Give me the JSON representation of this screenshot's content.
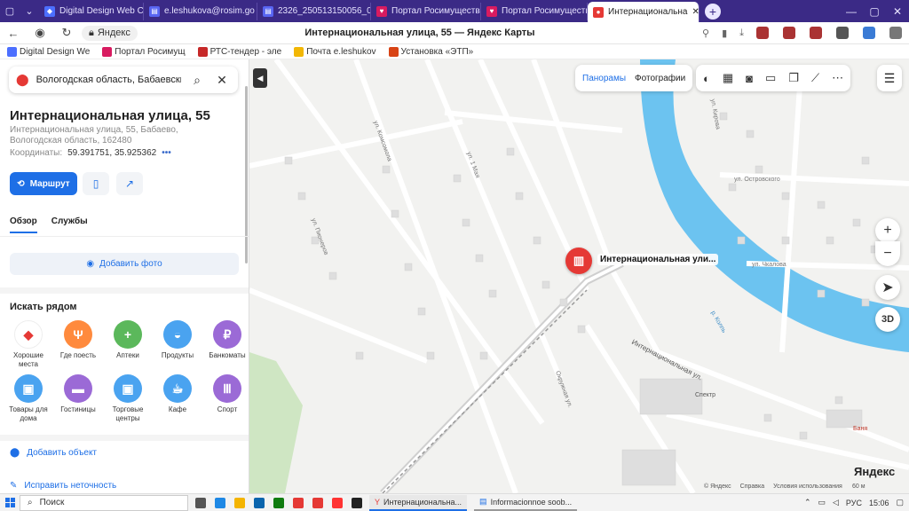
{
  "browser": {
    "tabs": [
      {
        "title": "Digital Design Web Cli",
        "color": "#4c6fff"
      },
      {
        "title": "e.leshukova@rosim.go",
        "color": "#5865f2"
      },
      {
        "title": "2326_250513150056_0",
        "color": "#5865f2"
      },
      {
        "title": "Портал Росимущества",
        "color": "#d81b60"
      },
      {
        "title": "Портал Росимущества",
        "color": "#d81b60"
      },
      {
        "title": "Интернациональна",
        "color": "#e53935"
      }
    ],
    "site_label": "Яндекс",
    "page_title": "Интернациональная улица, 55 — Яндекс Карты",
    "bookmarks": [
      "Digital Design We",
      "Портал Росимущ",
      "РТС-тендер - эле",
      "Почта e.leshukov",
      "Установка «ЭТП»"
    ]
  },
  "panel": {
    "search_value": "Вологодская область, Бабаевский ра",
    "place_title": "Интернациональная улица, 55",
    "address": "Интернациональная улица, 55, Бабаево, Вологодская область, 162480",
    "coords_label": "Координаты:",
    "coords_value": "59.391751, 35.925362",
    "coords_more": "•••",
    "route_label": "Маршрут",
    "tabs": [
      "Обзор",
      "Службы"
    ],
    "add_photo_label": "Добавить фото",
    "nearby_title": "Искать рядом",
    "categories": [
      {
        "label": "Хорошие места",
        "color": "#ffffff",
        "glyph": "◆"
      },
      {
        "label": "Где поесть",
        "color": "#ff8a3d",
        "glyph": "Ψ"
      },
      {
        "label": "Аптеки",
        "color": "#5bb85b",
        "glyph": "+"
      },
      {
        "label": "Продукты",
        "color": "#4aa3f0",
        "glyph": "◒"
      },
      {
        "label": "Банкоматы",
        "color": "#9b6ad6",
        "glyph": "₽"
      },
      {
        "label": "Товары для дома",
        "color": "#4aa3f0",
        "glyph": "▣"
      },
      {
        "label": "Гостиницы",
        "color": "#9b6ad6",
        "glyph": "▬"
      },
      {
        "label": "Торговые центры",
        "color": "#4aa3f0",
        "glyph": "▣"
      },
      {
        "label": "Кафе",
        "color": "#4aa3f0",
        "glyph": "☕"
      },
      {
        "label": "Спорт",
        "color": "#9b6ad6",
        "glyph": "Ⅲ"
      }
    ],
    "add_object_label": "Добавить объект",
    "fix_label": "Исправить неточность"
  },
  "map": {
    "layer_panoramas": "Панорамы",
    "layer_photos": "Фотографии",
    "marker_label": "Интернациональная ули...",
    "logo": "Яндекс",
    "footer": [
      "© Яндекс",
      "Справка",
      "Условия использования"
    ],
    "scale": "60 м",
    "zoom_in": "+",
    "zoom_out": "−",
    "btn_3d": "3D",
    "streets": [
      "ул. Комсомола",
      "ул. Пионеров",
      "ул. 1 Мая",
      "Интернациональная ул.",
      "ул. Островского",
      "ул. Чкалова",
      "ул. Кирова",
      "р. Колпь",
      "Окружная ул.",
      "Спектр",
      "Баня"
    ]
  },
  "taskbar": {
    "search_label": "Поиск",
    "task_yandex": "Интернациональна...",
    "task_doc": "Informacionnoe soob...",
    "lang": "РУС",
    "time": "15:06"
  }
}
